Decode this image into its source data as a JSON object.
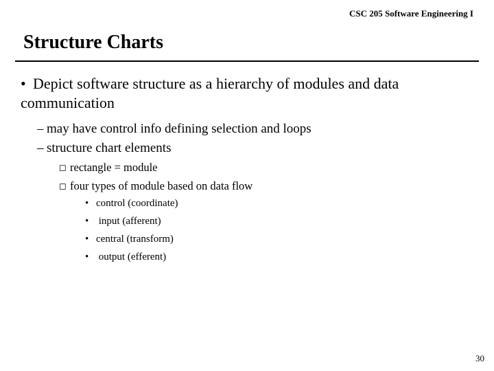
{
  "header": {
    "course": "CSC 205 Software Engineering I"
  },
  "title": "Structure Charts",
  "bullets": {
    "lvl1": "Depict software structure as a hierarchy of modules and data communication",
    "lvl2a": "may have control info defining selection and loops",
    "lvl2b": "structure chart elements",
    "lvl3a": "rectangle = module",
    "lvl3b": "four types of module based on data flow",
    "lvl4a": "control (coordinate)",
    "lvl4b": " input (afferent)",
    "lvl4c": "central (transform)",
    "lvl4d": " output (efferent)"
  },
  "page": "30"
}
